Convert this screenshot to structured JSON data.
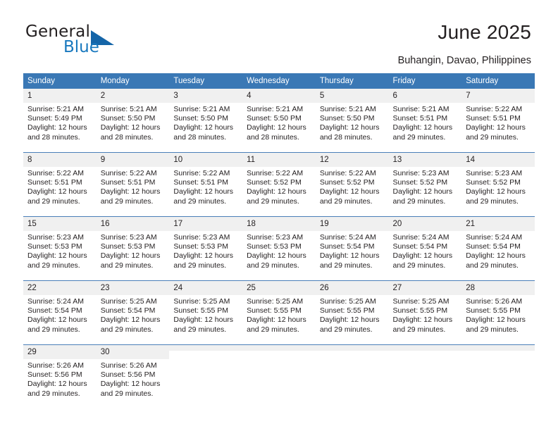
{
  "brand": {
    "name_top": "General",
    "name_bottom": "Blue",
    "triangle_color": "#1565a8",
    "blue_color": "#1878be"
  },
  "header": {
    "title": "June 2025",
    "subtitle": "Buhangin, Davao, Philippines"
  },
  "theme": {
    "header_blue": "#3a78b5",
    "daynum_bg": "#f0f0f0",
    "row_divider": "#4a7fb8",
    "text": "#231f20"
  },
  "weekdays": [
    "Sunday",
    "Monday",
    "Tuesday",
    "Wednesday",
    "Thursday",
    "Friday",
    "Saturday"
  ],
  "labels": {
    "sunrise_prefix": "Sunrise:",
    "sunset_prefix": "Sunset:",
    "daylight_prefix": "Daylight:"
  },
  "weeks": [
    [
      {
        "day": "1",
        "sunrise": "Sunrise: 5:21 AM",
        "sunset": "Sunset: 5:49 PM",
        "daylight_1": "Daylight: 12 hours",
        "daylight_2": "and 28 minutes."
      },
      {
        "day": "2",
        "sunrise": "Sunrise: 5:21 AM",
        "sunset": "Sunset: 5:50 PM",
        "daylight_1": "Daylight: 12 hours",
        "daylight_2": "and 28 minutes."
      },
      {
        "day": "3",
        "sunrise": "Sunrise: 5:21 AM",
        "sunset": "Sunset: 5:50 PM",
        "daylight_1": "Daylight: 12 hours",
        "daylight_2": "and 28 minutes."
      },
      {
        "day": "4",
        "sunrise": "Sunrise: 5:21 AM",
        "sunset": "Sunset: 5:50 PM",
        "daylight_1": "Daylight: 12 hours",
        "daylight_2": "and 28 minutes."
      },
      {
        "day": "5",
        "sunrise": "Sunrise: 5:21 AM",
        "sunset": "Sunset: 5:50 PM",
        "daylight_1": "Daylight: 12 hours",
        "daylight_2": "and 28 minutes."
      },
      {
        "day": "6",
        "sunrise": "Sunrise: 5:21 AM",
        "sunset": "Sunset: 5:51 PM",
        "daylight_1": "Daylight: 12 hours",
        "daylight_2": "and 29 minutes."
      },
      {
        "day": "7",
        "sunrise": "Sunrise: 5:22 AM",
        "sunset": "Sunset: 5:51 PM",
        "daylight_1": "Daylight: 12 hours",
        "daylight_2": "and 29 minutes."
      }
    ],
    [
      {
        "day": "8",
        "sunrise": "Sunrise: 5:22 AM",
        "sunset": "Sunset: 5:51 PM",
        "daylight_1": "Daylight: 12 hours",
        "daylight_2": "and 29 minutes."
      },
      {
        "day": "9",
        "sunrise": "Sunrise: 5:22 AM",
        "sunset": "Sunset: 5:51 PM",
        "daylight_1": "Daylight: 12 hours",
        "daylight_2": "and 29 minutes."
      },
      {
        "day": "10",
        "sunrise": "Sunrise: 5:22 AM",
        "sunset": "Sunset: 5:51 PM",
        "daylight_1": "Daylight: 12 hours",
        "daylight_2": "and 29 minutes."
      },
      {
        "day": "11",
        "sunrise": "Sunrise: 5:22 AM",
        "sunset": "Sunset: 5:52 PM",
        "daylight_1": "Daylight: 12 hours",
        "daylight_2": "and 29 minutes."
      },
      {
        "day": "12",
        "sunrise": "Sunrise: 5:22 AM",
        "sunset": "Sunset: 5:52 PM",
        "daylight_1": "Daylight: 12 hours",
        "daylight_2": "and 29 minutes."
      },
      {
        "day": "13",
        "sunrise": "Sunrise: 5:23 AM",
        "sunset": "Sunset: 5:52 PM",
        "daylight_1": "Daylight: 12 hours",
        "daylight_2": "and 29 minutes."
      },
      {
        "day": "14",
        "sunrise": "Sunrise: 5:23 AM",
        "sunset": "Sunset: 5:52 PM",
        "daylight_1": "Daylight: 12 hours",
        "daylight_2": "and 29 minutes."
      }
    ],
    [
      {
        "day": "15",
        "sunrise": "Sunrise: 5:23 AM",
        "sunset": "Sunset: 5:53 PM",
        "daylight_1": "Daylight: 12 hours",
        "daylight_2": "and 29 minutes."
      },
      {
        "day": "16",
        "sunrise": "Sunrise: 5:23 AM",
        "sunset": "Sunset: 5:53 PM",
        "daylight_1": "Daylight: 12 hours",
        "daylight_2": "and 29 minutes."
      },
      {
        "day": "17",
        "sunrise": "Sunrise: 5:23 AM",
        "sunset": "Sunset: 5:53 PM",
        "daylight_1": "Daylight: 12 hours",
        "daylight_2": "and 29 minutes."
      },
      {
        "day": "18",
        "sunrise": "Sunrise: 5:23 AM",
        "sunset": "Sunset: 5:53 PM",
        "daylight_1": "Daylight: 12 hours",
        "daylight_2": "and 29 minutes."
      },
      {
        "day": "19",
        "sunrise": "Sunrise: 5:24 AM",
        "sunset": "Sunset: 5:54 PM",
        "daylight_1": "Daylight: 12 hours",
        "daylight_2": "and 29 minutes."
      },
      {
        "day": "20",
        "sunrise": "Sunrise: 5:24 AM",
        "sunset": "Sunset: 5:54 PM",
        "daylight_1": "Daylight: 12 hours",
        "daylight_2": "and 29 minutes."
      },
      {
        "day": "21",
        "sunrise": "Sunrise: 5:24 AM",
        "sunset": "Sunset: 5:54 PM",
        "daylight_1": "Daylight: 12 hours",
        "daylight_2": "and 29 minutes."
      }
    ],
    [
      {
        "day": "22",
        "sunrise": "Sunrise: 5:24 AM",
        "sunset": "Sunset: 5:54 PM",
        "daylight_1": "Daylight: 12 hours",
        "daylight_2": "and 29 minutes."
      },
      {
        "day": "23",
        "sunrise": "Sunrise: 5:25 AM",
        "sunset": "Sunset: 5:54 PM",
        "daylight_1": "Daylight: 12 hours",
        "daylight_2": "and 29 minutes."
      },
      {
        "day": "24",
        "sunrise": "Sunrise: 5:25 AM",
        "sunset": "Sunset: 5:55 PM",
        "daylight_1": "Daylight: 12 hours",
        "daylight_2": "and 29 minutes."
      },
      {
        "day": "25",
        "sunrise": "Sunrise: 5:25 AM",
        "sunset": "Sunset: 5:55 PM",
        "daylight_1": "Daylight: 12 hours",
        "daylight_2": "and 29 minutes."
      },
      {
        "day": "26",
        "sunrise": "Sunrise: 5:25 AM",
        "sunset": "Sunset: 5:55 PM",
        "daylight_1": "Daylight: 12 hours",
        "daylight_2": "and 29 minutes."
      },
      {
        "day": "27",
        "sunrise": "Sunrise: 5:25 AM",
        "sunset": "Sunset: 5:55 PM",
        "daylight_1": "Daylight: 12 hours",
        "daylight_2": "and 29 minutes."
      },
      {
        "day": "28",
        "sunrise": "Sunrise: 5:26 AM",
        "sunset": "Sunset: 5:55 PM",
        "daylight_1": "Daylight: 12 hours",
        "daylight_2": "and 29 minutes."
      }
    ],
    [
      {
        "day": "29",
        "sunrise": "Sunrise: 5:26 AM",
        "sunset": "Sunset: 5:56 PM",
        "daylight_1": "Daylight: 12 hours",
        "daylight_2": "and 29 minutes."
      },
      {
        "day": "30",
        "sunrise": "Sunrise: 5:26 AM",
        "sunset": "Sunset: 5:56 PM",
        "daylight_1": "Daylight: 12 hours",
        "daylight_2": "and 29 minutes."
      },
      {
        "day": "",
        "sunrise": "",
        "sunset": "",
        "daylight_1": "",
        "daylight_2": ""
      },
      {
        "day": "",
        "sunrise": "",
        "sunset": "",
        "daylight_1": "",
        "daylight_2": ""
      },
      {
        "day": "",
        "sunrise": "",
        "sunset": "",
        "daylight_1": "",
        "daylight_2": ""
      },
      {
        "day": "",
        "sunrise": "",
        "sunset": "",
        "daylight_1": "",
        "daylight_2": ""
      },
      {
        "day": "",
        "sunrise": "",
        "sunset": "",
        "daylight_1": "",
        "daylight_2": ""
      }
    ]
  ]
}
